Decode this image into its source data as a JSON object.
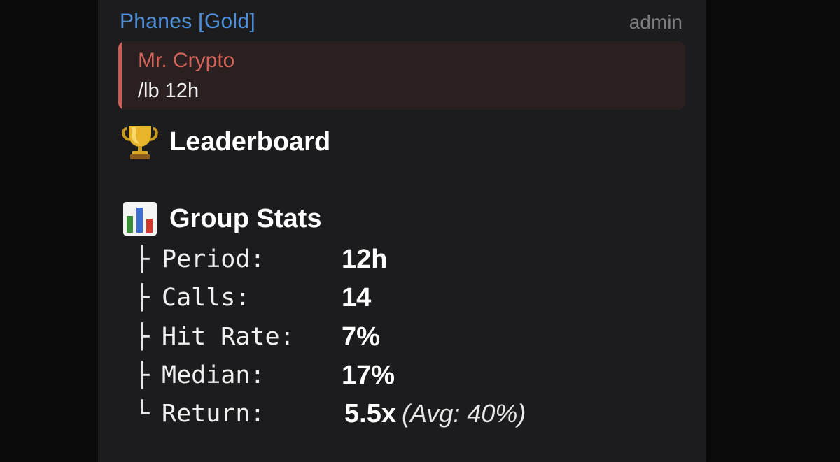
{
  "message": {
    "sender": "Phanes [Gold]",
    "role": "admin",
    "reply": {
      "author": "Mr. Crypto",
      "text": "/lb 12h"
    },
    "leaderboard_title": "Leaderboard",
    "stats_title": "Group Stats",
    "stats": [
      {
        "branch": "├",
        "label": "Period:",
        "value": "12h"
      },
      {
        "branch": "├",
        "label": "Calls:",
        "value": "14"
      },
      {
        "branch": "├",
        "label": "Hit Rate:",
        "value": "7%"
      },
      {
        "branch": "├",
        "label": "Median:",
        "value": "17%"
      },
      {
        "branch": "└",
        "label": "Return:",
        "value": "5.5x",
        "extra": "(Avg: 40%)"
      }
    ]
  },
  "icons": {
    "leaderboard": "trophy-icon",
    "stats": "bar-chart-icon"
  },
  "colors": {
    "sender": "#4d8fd8",
    "reply_accent": "#cc5a50",
    "bubble": "#1c1c1e",
    "background": "#0a0a0a"
  }
}
